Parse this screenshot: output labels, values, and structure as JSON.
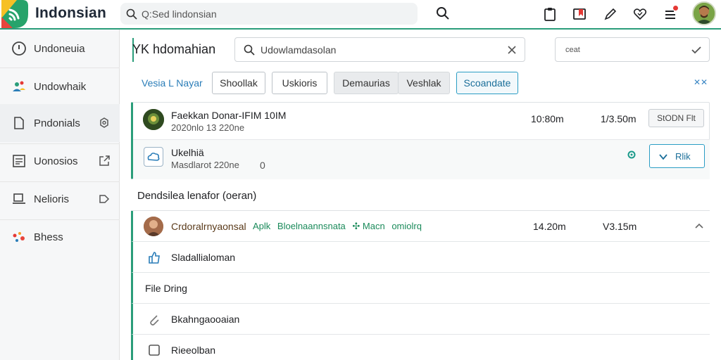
{
  "app": {
    "title": "Indonsian"
  },
  "topbar": {
    "search_placeholder": "Q:Sed lindonsian",
    "icons": [
      "search-icon",
      "clipboard-icon",
      "bookmark-icon",
      "pen-icon",
      "heart-icon",
      "menu-icon",
      "avatar"
    ],
    "accent": "#2a9d7a"
  },
  "sidebar": {
    "items": [
      {
        "label": "Undoneuia",
        "icon": "info-circle-icon"
      },
      {
        "label": "Undowhaik",
        "icon": "people-icon"
      },
      {
        "label": "Pndonials",
        "icon": "document-icon",
        "trail": "settings-icon"
      },
      {
        "label": "Uonosios",
        "icon": "list-icon",
        "trail": "share-icon"
      },
      {
        "label": "Nelioris",
        "icon": "device-icon",
        "trail": "forward-icon"
      },
      {
        "label": "Bhess",
        "icon": "dots-icon"
      }
    ]
  },
  "main": {
    "title": "YK hdomahian",
    "search_value": "Udowlamdasolan",
    "select_value": "ceat",
    "filter_link": "Vesia L Nayar",
    "chips": [
      "Shoollak",
      "Uskioris",
      "Demaurias",
      "Veshlak",
      "Scoandate"
    ],
    "clear_link": "✕✕",
    "card": {
      "row1": {
        "title": "Faekkan Donar-IFIM 10IM",
        "sub": "2020nlo 13 220ne",
        "time1": "10:80m",
        "time2": "1/3.50m",
        "button": "StODN Flt"
      },
      "row2": {
        "title": "Ukelhiä",
        "sub": "Masdlarot 220ne",
        "counter": "0",
        "button": "Rlik"
      }
    },
    "section_title": "Dendsilea lenafor (oeran)",
    "list": [
      {
        "label": "Crdoralrnyaonsal",
        "tags": [
          "Aplk",
          "Bloelnaannsnata",
          "✣ Macn",
          "omiolrq"
        ],
        "time1": "14.20m",
        "time2": "V3.15m"
      },
      {
        "label": "Sladallialoman"
      },
      {
        "label": "File Dring"
      },
      {
        "label": "Bkahngaooaian"
      },
      {
        "label": "Rieeolban"
      }
    ]
  }
}
